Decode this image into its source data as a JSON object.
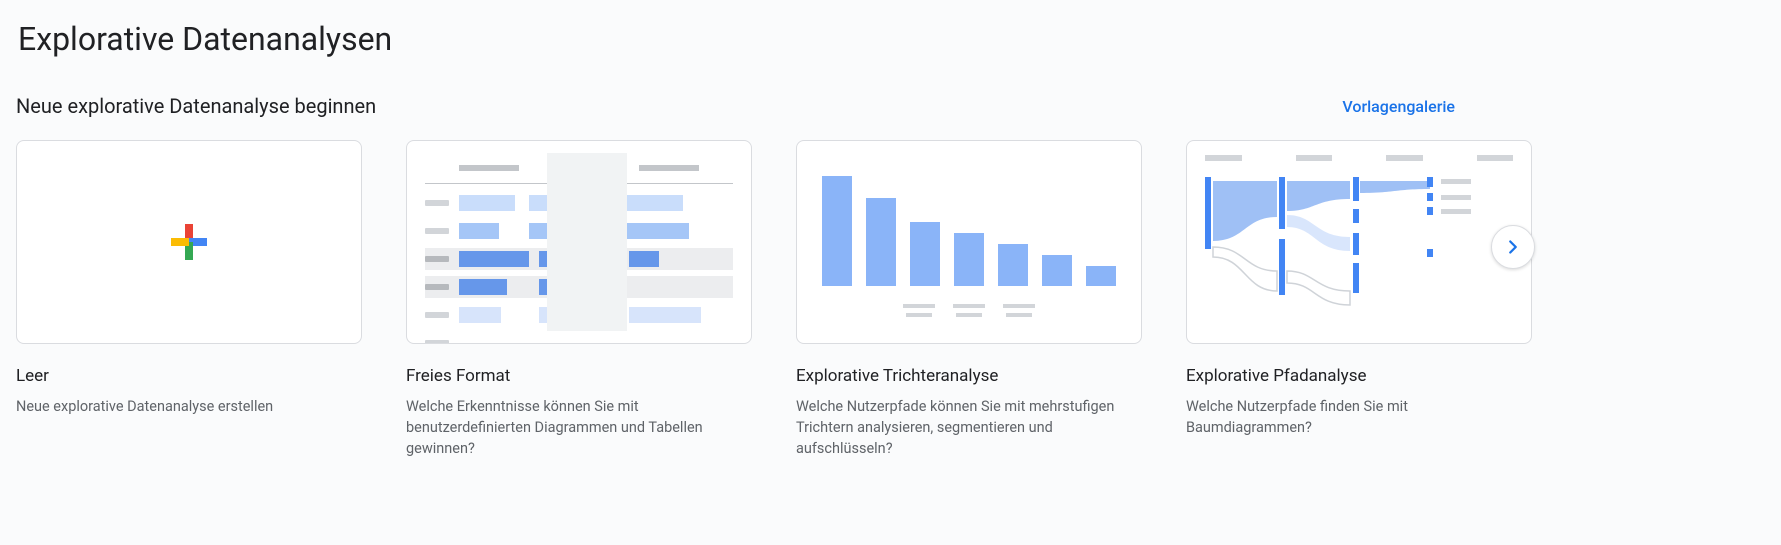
{
  "page": {
    "title": "Explorative Datenanalysen",
    "subtitle": "Neue explorative Datenanalyse beginnen",
    "gallery_link": "Vorlagengalerie"
  },
  "templates": {
    "blank": {
      "title": "Leer",
      "description": "Neue explorative Datenanalyse erstellen"
    },
    "freeform": {
      "title": "Freies Format",
      "description": "Welche Erkenntnisse können Sie mit benutzerdefinierten Diagrammen und Tabellen gewinnen?"
    },
    "funnel": {
      "title": "Explorative Trichteranalyse",
      "description": "Welche Nutzerpfade können Sie mit mehrstufigen Trichtern analysieren, segmentieren und aufschlüsseln?"
    },
    "path": {
      "title": "Explorative Pfadanalyse",
      "description": "Welche Nutzerpfade finden Sie mit Baumdiagrammen?"
    }
  }
}
